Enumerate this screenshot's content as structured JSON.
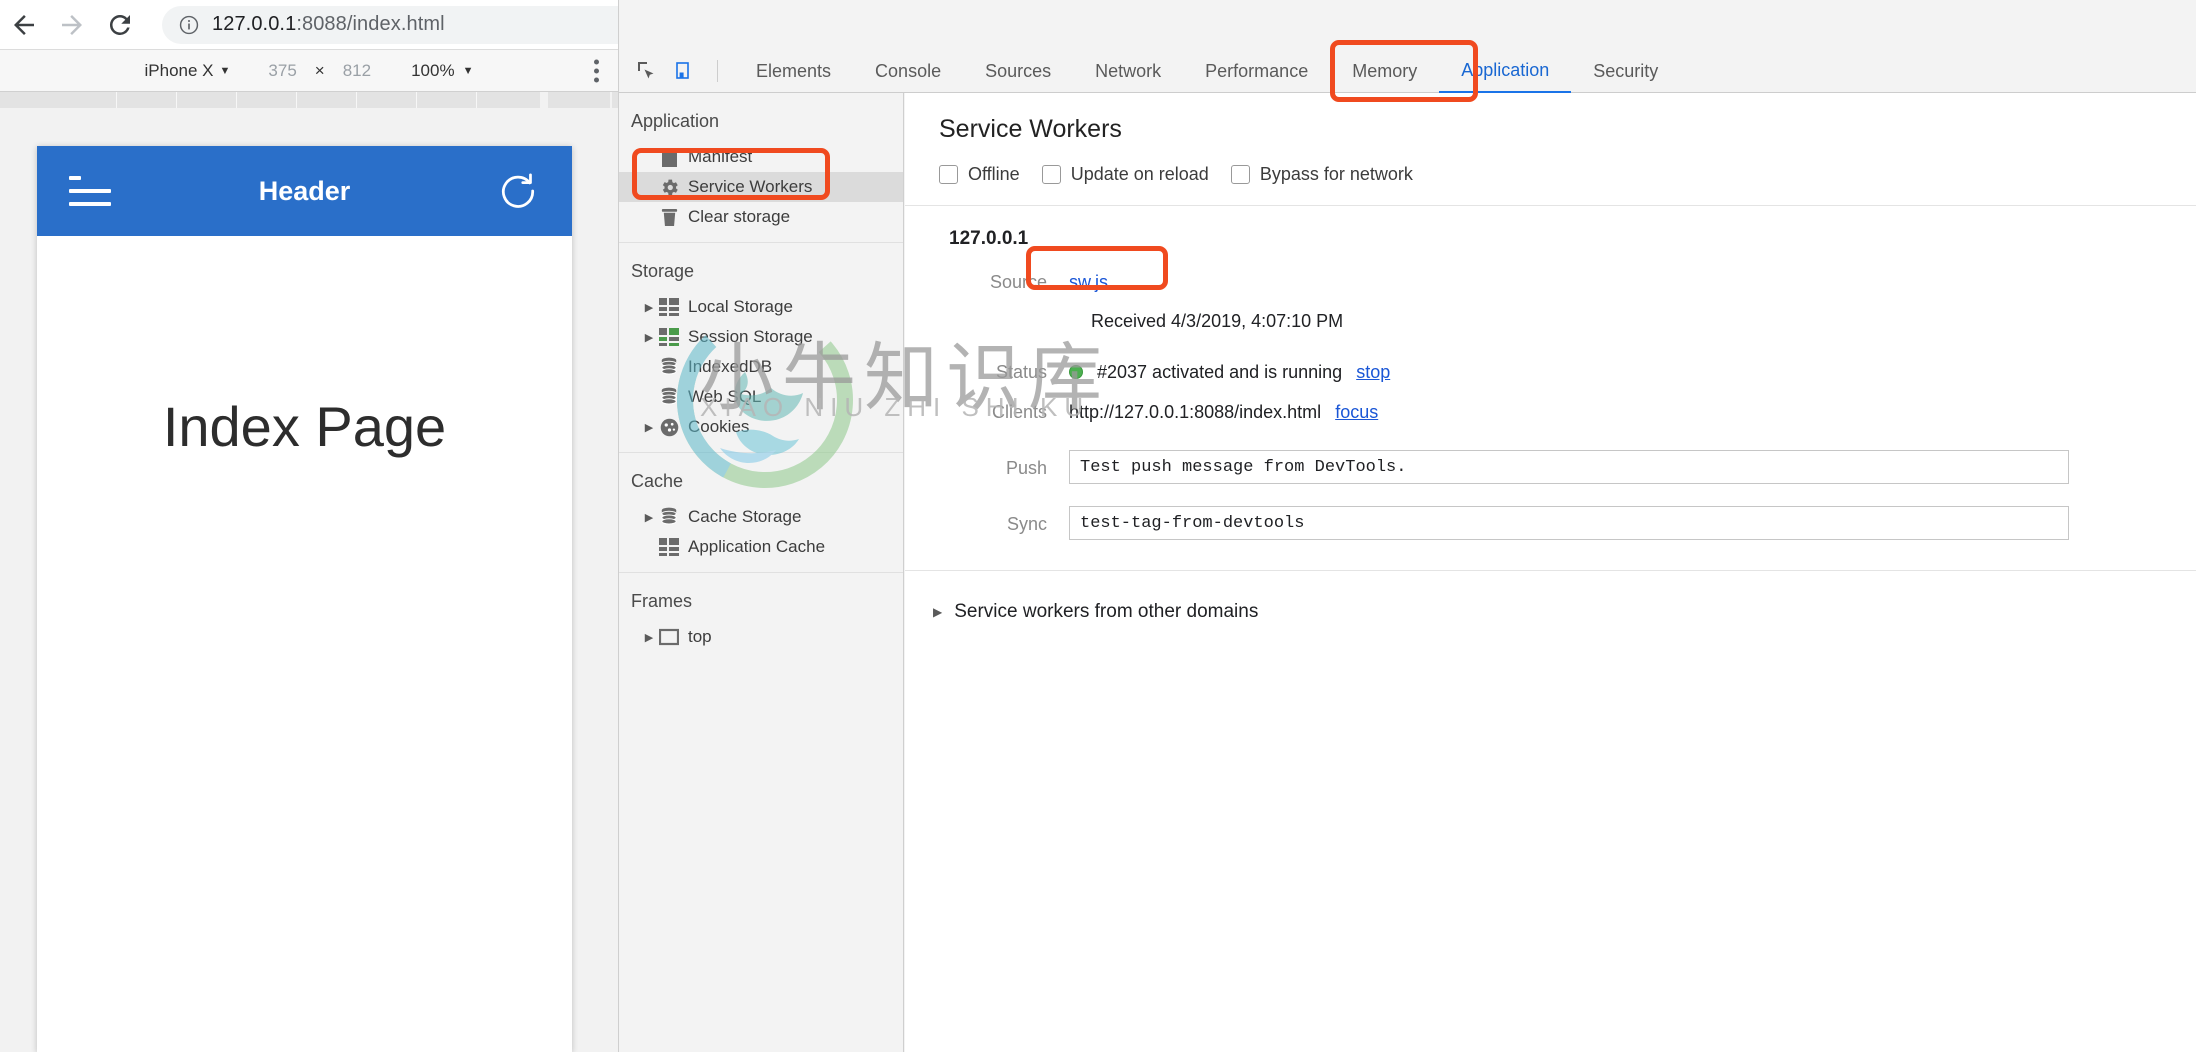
{
  "browser": {
    "back_icon": "back-arrow-icon",
    "forward_icon": "forward-arrow-icon",
    "reload_icon": "reload-icon",
    "info_icon": "info-circle-icon",
    "url_host": "127.0.0.1",
    "url_rest": ":8088/index.html",
    "url_full": "127.0.0.1:8088/index.html"
  },
  "device_toolbar": {
    "device": "iPhone X",
    "caret": "▼",
    "width": "375",
    "x": "×",
    "height": "812",
    "zoom": "100%",
    "zoom_caret": "▼",
    "menu_icon": "more-vertical-icon"
  },
  "page_preview": {
    "menu_icon": "hamburger-menu-icon",
    "title": "Header",
    "refresh_icon": "refresh-icon",
    "body_title": "Index Page"
  },
  "devtools": {
    "inspect_icon": "inspect-element-icon",
    "device_toggle_icon": "device-toolbar-icon",
    "tabs": [
      {
        "label": "Elements",
        "active": false
      },
      {
        "label": "Console",
        "active": false
      },
      {
        "label": "Sources",
        "active": false
      },
      {
        "label": "Network",
        "active": false
      },
      {
        "label": "Performance",
        "active": false
      },
      {
        "label": "Memory",
        "active": false
      },
      {
        "label": "Application",
        "active": true
      },
      {
        "label": "Security",
        "active": false
      }
    ],
    "sidebar": [
      {
        "title": "Application",
        "items": [
          {
            "label": "Manifest",
            "icon": "manifest-file-icon",
            "arrow": false,
            "selected": false
          },
          {
            "label": "Service Workers",
            "icon": "gear-icon",
            "arrow": false,
            "selected": true
          },
          {
            "label": "Clear storage",
            "icon": "trash-icon",
            "arrow": false,
            "selected": false
          }
        ]
      },
      {
        "title": "Storage",
        "items": [
          {
            "label": "Local Storage",
            "icon": "table-grid-icon",
            "arrow": true,
            "selected": false
          },
          {
            "label": "Session Storage",
            "icon": "table-grid-green-icon",
            "arrow": true,
            "selected": false
          },
          {
            "label": "IndexedDB",
            "icon": "database-icon",
            "arrow": false,
            "selected": false
          },
          {
            "label": "Web SQL",
            "icon": "database-icon",
            "arrow": false,
            "selected": false
          },
          {
            "label": "Cookies",
            "icon": "cookie-icon",
            "arrow": true,
            "selected": false
          }
        ]
      },
      {
        "title": "Cache",
        "items": [
          {
            "label": "Cache Storage",
            "icon": "database-icon",
            "arrow": true,
            "selected": false
          },
          {
            "label": "Application Cache",
            "icon": "table-grid-icon",
            "arrow": false,
            "selected": false
          }
        ]
      },
      {
        "title": "Frames",
        "items": [
          {
            "label": "top",
            "icon": "frame-icon",
            "arrow": true,
            "selected": false
          }
        ]
      }
    ],
    "service_workers": {
      "panel_title": "Service Workers",
      "checkboxes": [
        {
          "label": "Offline",
          "checked": false
        },
        {
          "label": "Update on reload",
          "checked": false
        },
        {
          "label": "Bypass for network",
          "checked": false
        }
      ],
      "origin": "127.0.0.1",
      "source_label": "Source",
      "source_link": "sw.js",
      "received": "Received 4/3/2019, 4:07:10 PM",
      "status_label": "Status",
      "status_text": "#2037 activated and is running",
      "status_action": "stop",
      "status_color": "#4caf50",
      "clients_label": "Clients",
      "clients_value": "http://127.0.0.1:8088/index.html",
      "clients_action": "focus",
      "push_label": "Push",
      "push_value": "Test push message from DevTools.",
      "sync_label": "Sync",
      "sync_value": "test-tag-from-devtools",
      "other_domains": "Service workers from other domains",
      "other_domains_arrow": "▶"
    }
  },
  "watermark": {
    "cn": "小牛知识库",
    "en": "XIAO NIU ZHI SHI KU"
  },
  "annotations": {
    "accent_color": "#f04a1f",
    "boxes": [
      {
        "name": "application-tab-highlight"
      },
      {
        "name": "service-workers-sidebar-highlight"
      },
      {
        "name": "source-row-highlight"
      }
    ]
  }
}
